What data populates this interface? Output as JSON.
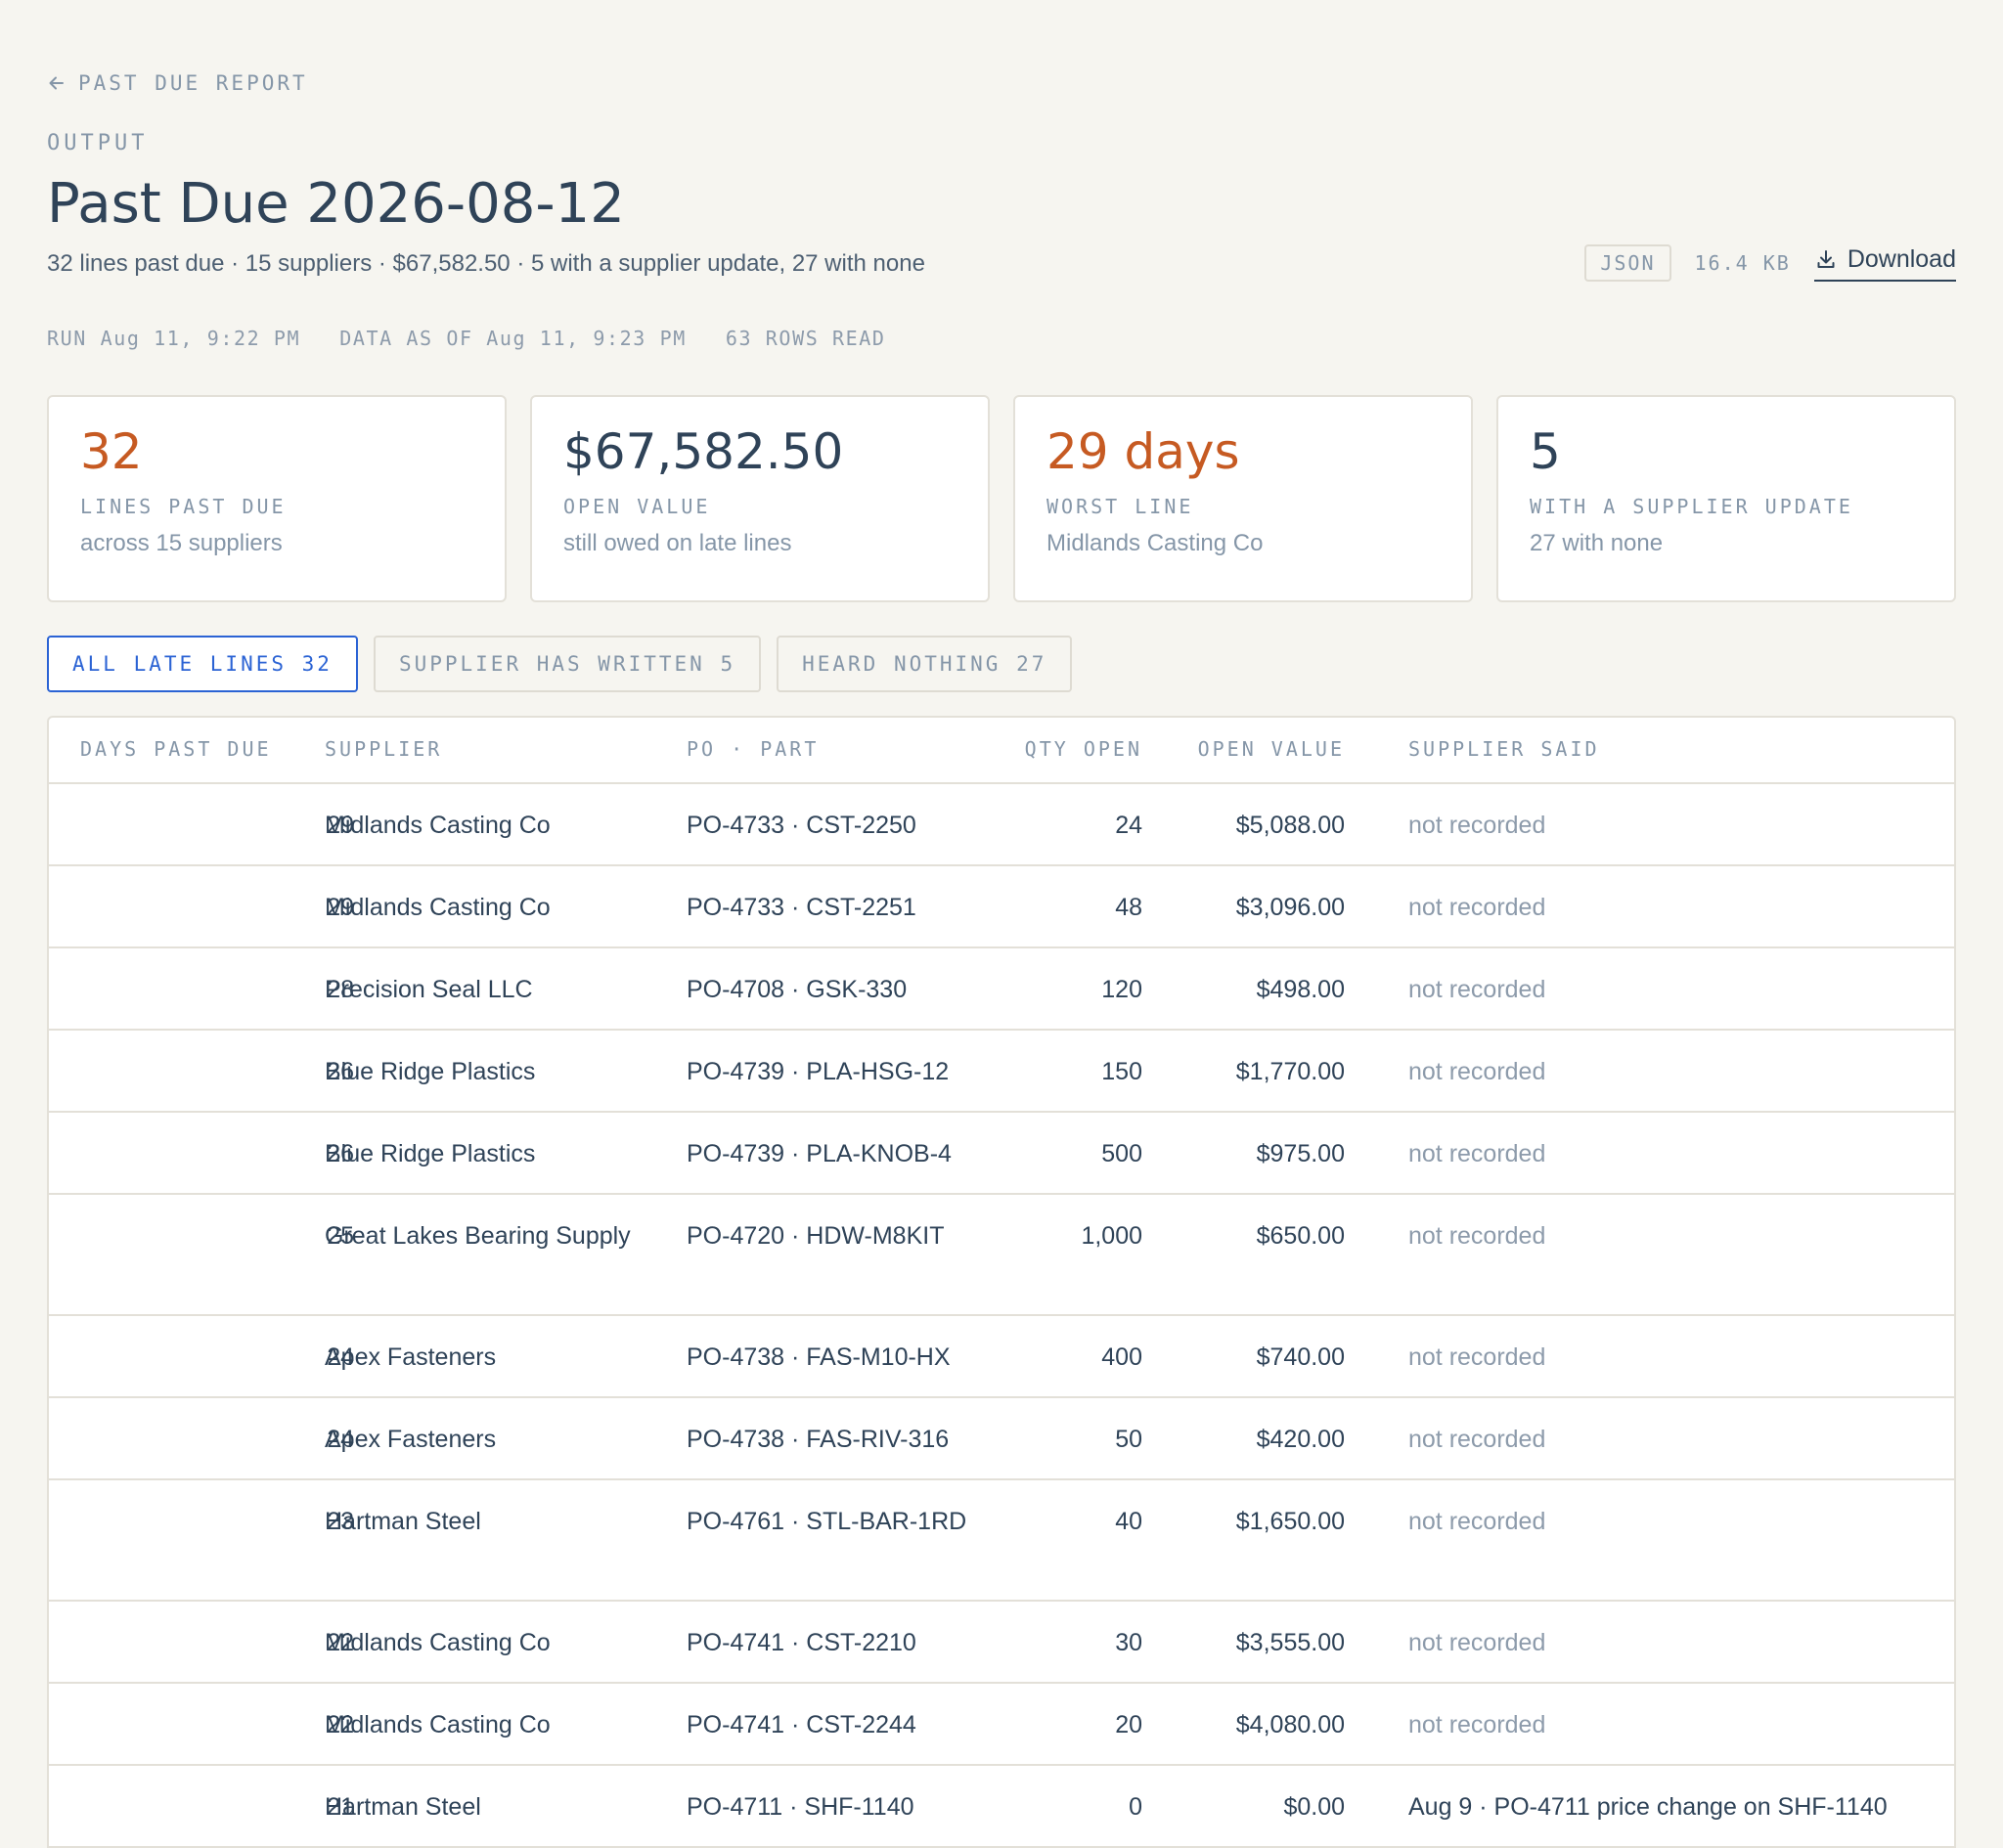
{
  "back_link": {
    "label": "PAST DUE REPORT"
  },
  "eyebrow": "OUTPUT",
  "title": "Past Due 2026-08-12",
  "subtitle": "32 lines past due · 15 suppliers · $67,582.50 · 5 with a supplier update, 27 with none",
  "file": {
    "format": "JSON",
    "size": "16.4 KB",
    "download_label": "Download"
  },
  "meta": {
    "run": "RUN Aug 11, 9:22 PM",
    "data_as_of": "DATA AS OF Aug 11, 9:23 PM",
    "rows_read": "63 ROWS READ"
  },
  "cards": [
    {
      "value": "32",
      "label": "LINES PAST DUE",
      "note": "across 15 suppliers",
      "color": "#c65a22"
    },
    {
      "value": "$67,582.50",
      "label": "OPEN VALUE",
      "note": "still owed on late lines",
      "color": "#2f4358"
    },
    {
      "value": "29 days",
      "label": "WORST LINE",
      "note": "Midlands Casting Co",
      "color": "#c65a22"
    },
    {
      "value": "5",
      "label": "WITH A SUPPLIER UPDATE",
      "note": "27 with none",
      "color": "#2f4358"
    }
  ],
  "tabs": [
    {
      "label": "ALL LATE LINES 32",
      "active": true
    },
    {
      "label": "SUPPLIER HAS WRITTEN 5",
      "active": false
    },
    {
      "label": "HEARD NOTHING 27",
      "active": false
    }
  ],
  "table": {
    "headers": {
      "days": "DAYS PAST DUE",
      "supplier": "SUPPLIER",
      "po": "PO · PART",
      "qty": "QTY OPEN",
      "value": "OPEN VALUE",
      "said": "SUPPLIER SAID"
    },
    "rows": [
      {
        "days": "29",
        "supplier": "Midlands Casting Co",
        "po": "PO-4733 · CST-2250",
        "qty": "24",
        "value": "$5,088.00",
        "said": "not recorded"
      },
      {
        "days": "29",
        "supplier": "Midlands Casting Co",
        "po": "PO-4733 · CST-2251",
        "qty": "48",
        "value": "$3,096.00",
        "said": "not recorded"
      },
      {
        "days": "28",
        "supplier": "Precision Seal LLC",
        "po": "PO-4708 · GSK-330",
        "qty": "120",
        "value": "$498.00",
        "said": "not recorded"
      },
      {
        "days": "26",
        "supplier": "Blue Ridge Plastics",
        "po": "PO-4739 · PLA-HSG-12",
        "qty": "150",
        "value": "$1,770.00",
        "said": "not recorded"
      },
      {
        "days": "26",
        "supplier": "Blue Ridge Plastics",
        "po": "PO-4739 · PLA-KNOB-4",
        "qty": "500",
        "value": "$975.00",
        "said": "not recorded"
      },
      {
        "days": "25",
        "supplier": "Great Lakes Bearing Supply",
        "po": "PO-4720 · HDW-M8KIT",
        "qty": "1,000",
        "value": "$650.00",
        "said": "not recorded"
      },
      {
        "days": "24",
        "supplier": "Apex Fasteners",
        "po": "PO-4738 · FAS-M10-HX",
        "qty": "400",
        "value": "$740.00",
        "said": "not recorded"
      },
      {
        "days": "24",
        "supplier": "Apex Fasteners",
        "po": "PO-4738 · FAS-RIV-316",
        "qty": "50",
        "value": "$420.00",
        "said": "not recorded"
      },
      {
        "days": "23",
        "supplier": "Hartman Steel",
        "po": "PO-4761 · STL-BAR-1RD",
        "qty": "40",
        "value": "$1,650.00",
        "said": "not recorded"
      },
      {
        "days": "22",
        "supplier": "Midlands Casting Co",
        "po": "PO-4741 · CST-2210",
        "qty": "30",
        "value": "$3,555.00",
        "said": "not recorded"
      },
      {
        "days": "22",
        "supplier": "Midlands Casting Co",
        "po": "PO-4741 · CST-2244",
        "qty": "20",
        "value": "$4,080.00",
        "said": "not recorded"
      },
      {
        "days": "21",
        "supplier": "Hartman Steel",
        "po": "PO-4711 · SHF-1140",
        "qty": "0",
        "value": "$0.00",
        "said": "Aug 9 · PO-4711 price change on SHF-1140"
      }
    ]
  }
}
